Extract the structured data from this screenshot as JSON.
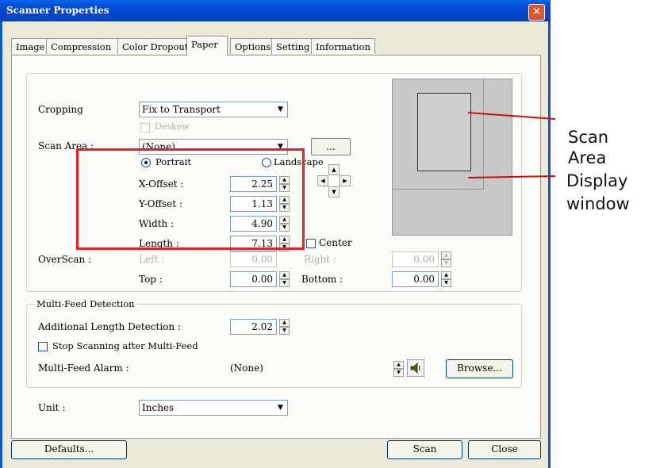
{
  "window": {
    "title": "Scanner Properties",
    "close_glyph": "✕"
  },
  "tabs": [
    {
      "label": "Image"
    },
    {
      "label": "Compression"
    },
    {
      "label": "Color Dropout"
    },
    {
      "label": "Paper"
    },
    {
      "label": "Options"
    },
    {
      "label": "Setting"
    },
    {
      "label": "Information"
    }
  ],
  "active_tab": "Paper",
  "cropping": {
    "label": "Cropping",
    "value": "Fix to Transport",
    "deskew_label": "Deskew"
  },
  "scan_area": {
    "label": "Scan Area :",
    "value": "(None)",
    "browse_label": "...",
    "portrait_label": "Portrait",
    "landscape_label": "Landscape",
    "orientation": "Portrait"
  },
  "offsets": {
    "x_label": "X-Offset :",
    "x_value": "2.25",
    "y_label": "Y-Offset :",
    "y_value": "1.13",
    "width_label": "Width :",
    "width_value": "4.90",
    "length_label": "Length :",
    "length_value": "7.13",
    "center_label": "Center"
  },
  "overscan": {
    "label": "OverScan :",
    "left_label": "Left :",
    "left_value": "0.00",
    "right_label": "Right :",
    "right_value": "0.00",
    "top_label": "Top :",
    "top_value": "0.00",
    "bottom_label": "Bottom :",
    "bottom_value": "0.00"
  },
  "multifeed": {
    "group_label": "Multi-Feed Detection",
    "additional_label": "Additional Length Detection :",
    "additional_value": "2.02",
    "stop_label": "Stop Scanning after Multi-Feed",
    "alarm_label": "Multi-Feed Alarm :",
    "alarm_value": "(None)",
    "browse_label": "Browse..."
  },
  "unit": {
    "label": "Unit :",
    "value": "Inches"
  },
  "footer": {
    "defaults_label": "Defaults...",
    "scan_label": "Scan",
    "close_label": "Close"
  },
  "annotations": {
    "scan_area": "Scan\nArea",
    "display_window": "Display\nwindow"
  },
  "colors": {
    "title_bar": "#0348d0",
    "highlight_box": "#e82020",
    "preview_bg": "#c8c8c8"
  }
}
